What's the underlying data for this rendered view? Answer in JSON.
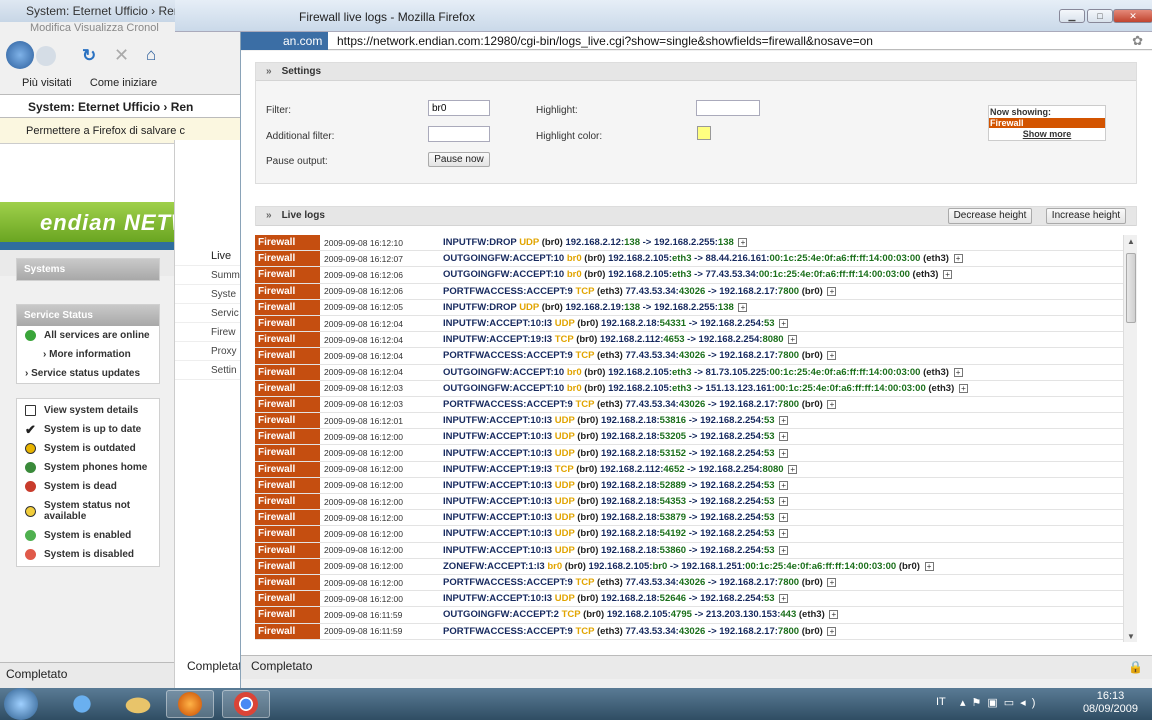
{
  "bg": {
    "title": "System: Eternet Ufficio › Remot",
    "menu": "Modifica  Visualizza  Cronol",
    "bookmarks": [
      "Più visitati",
      "Come iniziare"
    ],
    "tab": "System: Eternet Ufficio › Ren",
    "notify": "Permettere a Firefox di salvare c",
    "brand": "endian NETWORK",
    "systems": "Systems",
    "service_status": "Service Status",
    "svc_items": [
      "All services are online",
      "› More information",
      "› Service status updates"
    ],
    "legend": [
      "View system details",
      "System is up to date",
      "System is outdated",
      "System phones home",
      "System is dead",
      "System status not available",
      "System is enabled",
      "System is disabled"
    ],
    "mid_items": [
      "Live",
      "Summ",
      "Syste",
      "Servic",
      "Firew",
      "Proxy",
      "Settin"
    ],
    "status": "Completato",
    "status2": "Completat"
  },
  "window": {
    "title": "Firewall live logs - Mozilla Firefox",
    "site": "an.com",
    "url": "https://network.endian.com:12980/cgi-bin/logs_live.cgi?show=single&showfields=firewall&nosave=on",
    "status": "Completato"
  },
  "settings": {
    "header": "Settings",
    "filter_label": "Filter:",
    "filter_value": "br0",
    "additional_label": "Additional filter:",
    "additional_value": "",
    "pause_label": "Pause output:",
    "pause_button": "Pause now",
    "highlight_label": "Highlight:",
    "highlight_value": "",
    "highlight_color_label": "Highlight color:",
    "highlight_color": "#ffff80",
    "now_showing": "Now showing:",
    "showing_value": "Firewall",
    "show_more": "Show more"
  },
  "live": {
    "header": "Live logs",
    "decrease": "Decrease height",
    "increase": "Increase height",
    "rows": [
      {
        "src": "Firewall",
        "ts": "2009-09-08 16:12:10",
        "rule": "INPUTFW:DROP",
        "proto": "UDP",
        "iface": "(br0)",
        "from": "192.168.2.12:",
        "fport": "138",
        "arrow": "->",
        "to": "192.168.2.255:",
        "tport": "138",
        "extra": ""
      },
      {
        "src": "Firewall",
        "ts": "2009-09-08 16:12:07",
        "rule": "OUTGOINGFW:ACCEPT:10",
        "proto": "br0",
        "iface": "(br0)",
        "from": "192.168.2.105:",
        "fport": "eth3",
        "arrow": "->",
        "to": "88.44.216.161:",
        "tport": "00:1c:25:4e:0f:a6:ff:ff:14:00:03:00",
        "extra": "(eth3)"
      },
      {
        "src": "Firewall",
        "ts": "2009-09-08 16:12:06",
        "rule": "OUTGOINGFW:ACCEPT:10",
        "proto": "br0",
        "iface": "(br0)",
        "from": "192.168.2.105:",
        "fport": "eth3",
        "arrow": "->",
        "to": "77.43.53.34:",
        "tport": "00:1c:25:4e:0f:a6:ff:ff:14:00:03:00",
        "extra": "(eth3)"
      },
      {
        "src": "Firewall",
        "ts": "2009-09-08 16:12:06",
        "rule": "PORTFWACCESS:ACCEPT:9",
        "proto": "TCP",
        "iface": "(eth3)",
        "from": "77.43.53.34:",
        "fport": "43026",
        "arrow": "->",
        "to": "192.168.2.17:",
        "tport": "7800",
        "extra": "(br0)"
      },
      {
        "src": "Firewall",
        "ts": "2009-09-08 16:12:05",
        "rule": "INPUTFW:DROP",
        "proto": "UDP",
        "iface": "(br0)",
        "from": "192.168.2.19:",
        "fport": "138",
        "arrow": "->",
        "to": "192.168.2.255:",
        "tport": "138",
        "extra": ""
      },
      {
        "src": "Firewall",
        "ts": "2009-09-08 16:12:04",
        "rule": "INPUTFW:ACCEPT:10:l3",
        "proto": "UDP",
        "iface": "(br0)",
        "from": "192.168.2.18:",
        "fport": "54331",
        "arrow": "->",
        "to": "192.168.2.254:",
        "tport": "53",
        "extra": ""
      },
      {
        "src": "Firewall",
        "ts": "2009-09-08 16:12:04",
        "rule": "INPUTFW:ACCEPT:19:l3",
        "proto": "TCP",
        "iface": "(br0)",
        "from": "192.168.2.112:",
        "fport": "4653",
        "arrow": "->",
        "to": "192.168.2.254:",
        "tport": "8080",
        "extra": ""
      },
      {
        "src": "Firewall",
        "ts": "2009-09-08 16:12:04",
        "rule": "PORTFWACCESS:ACCEPT:9",
        "proto": "TCP",
        "iface": "(eth3)",
        "from": "77.43.53.34:",
        "fport": "43026",
        "arrow": "->",
        "to": "192.168.2.17:",
        "tport": "7800",
        "extra": "(br0)"
      },
      {
        "src": "Firewall",
        "ts": "2009-09-08 16:12:04",
        "rule": "OUTGOINGFW:ACCEPT:10",
        "proto": "br0",
        "iface": "(br0)",
        "from": "192.168.2.105:",
        "fport": "eth3",
        "arrow": "->",
        "to": "81.73.105.225:",
        "tport": "00:1c:25:4e:0f:a6:ff:ff:14:00:03:00",
        "extra": "(eth3)"
      },
      {
        "src": "Firewall",
        "ts": "2009-09-08 16:12:03",
        "rule": "OUTGOINGFW:ACCEPT:10",
        "proto": "br0",
        "iface": "(br0)",
        "from": "192.168.2.105:",
        "fport": "eth3",
        "arrow": "->",
        "to": "151.13.123.161:",
        "tport": "00:1c:25:4e:0f:a6:ff:ff:14:00:03:00",
        "extra": "(eth3)"
      },
      {
        "src": "Firewall",
        "ts": "2009-09-08 16:12:03",
        "rule": "PORTFWACCESS:ACCEPT:9",
        "proto": "TCP",
        "iface": "(eth3)",
        "from": "77.43.53.34:",
        "fport": "43026",
        "arrow": "->",
        "to": "192.168.2.17:",
        "tport": "7800",
        "extra": "(br0)"
      },
      {
        "src": "Firewall",
        "ts": "2009-09-08 16:12:01",
        "rule": "INPUTFW:ACCEPT:10:l3",
        "proto": "UDP",
        "iface": "(br0)",
        "from": "192.168.2.18:",
        "fport": "53816",
        "arrow": "->",
        "to": "192.168.2.254:",
        "tport": "53",
        "extra": ""
      },
      {
        "src": "Firewall",
        "ts": "2009-09-08 16:12:00",
        "rule": "INPUTFW:ACCEPT:10:l3",
        "proto": "UDP",
        "iface": "(br0)",
        "from": "192.168.2.18:",
        "fport": "53205",
        "arrow": "->",
        "to": "192.168.2.254:",
        "tport": "53",
        "extra": ""
      },
      {
        "src": "Firewall",
        "ts": "2009-09-08 16:12:00",
        "rule": "INPUTFW:ACCEPT:10:l3",
        "proto": "UDP",
        "iface": "(br0)",
        "from": "192.168.2.18:",
        "fport": "53152",
        "arrow": "->",
        "to": "192.168.2.254:",
        "tport": "53",
        "extra": ""
      },
      {
        "src": "Firewall",
        "ts": "2009-09-08 16:12:00",
        "rule": "INPUTFW:ACCEPT:19:l3",
        "proto": "TCP",
        "iface": "(br0)",
        "from": "192.168.2.112:",
        "fport": "4652",
        "arrow": "->",
        "to": "192.168.2.254:",
        "tport": "8080",
        "extra": ""
      },
      {
        "src": "Firewall",
        "ts": "2009-09-08 16:12:00",
        "rule": "INPUTFW:ACCEPT:10:l3",
        "proto": "UDP",
        "iface": "(br0)",
        "from": "192.168.2.18:",
        "fport": "52889",
        "arrow": "->",
        "to": "192.168.2.254:",
        "tport": "53",
        "extra": ""
      },
      {
        "src": "Firewall",
        "ts": "2009-09-08 16:12:00",
        "rule": "INPUTFW:ACCEPT:10:l3",
        "proto": "UDP",
        "iface": "(br0)",
        "from": "192.168.2.18:",
        "fport": "54353",
        "arrow": "->",
        "to": "192.168.2.254:",
        "tport": "53",
        "extra": ""
      },
      {
        "src": "Firewall",
        "ts": "2009-09-08 16:12:00",
        "rule": "INPUTFW:ACCEPT:10:l3",
        "proto": "UDP",
        "iface": "(br0)",
        "from": "192.168.2.18:",
        "fport": "53879",
        "arrow": "->",
        "to": "192.168.2.254:",
        "tport": "53",
        "extra": ""
      },
      {
        "src": "Firewall",
        "ts": "2009-09-08 16:12:00",
        "rule": "INPUTFW:ACCEPT:10:l3",
        "proto": "UDP",
        "iface": "(br0)",
        "from": "192.168.2.18:",
        "fport": "54192",
        "arrow": "->",
        "to": "192.168.2.254:",
        "tport": "53",
        "extra": ""
      },
      {
        "src": "Firewall",
        "ts": "2009-09-08 16:12:00",
        "rule": "INPUTFW:ACCEPT:10:l3",
        "proto": "UDP",
        "iface": "(br0)",
        "from": "192.168.2.18:",
        "fport": "53860",
        "arrow": "->",
        "to": "192.168.2.254:",
        "tport": "53",
        "extra": ""
      },
      {
        "src": "Firewall",
        "ts": "2009-09-08 16:12:00",
        "rule": "ZONEFW:ACCEPT:1:l3",
        "proto": "br0",
        "iface": "(br0)",
        "from": "192.168.2.105:",
        "fport": "br0",
        "arrow": "->",
        "to": "192.168.1.251:",
        "tport": "00:1c:25:4e:0f:a6:ff:ff:14:00:03:00",
        "extra": "(br0)"
      },
      {
        "src": "Firewall",
        "ts": "2009-09-08 16:12:00",
        "rule": "PORTFWACCESS:ACCEPT:9",
        "proto": "TCP",
        "iface": "(eth3)",
        "from": "77.43.53.34:",
        "fport": "43026",
        "arrow": "->",
        "to": "192.168.2.17:",
        "tport": "7800",
        "extra": "(br0)"
      },
      {
        "src": "Firewall",
        "ts": "2009-09-08 16:12:00",
        "rule": "INPUTFW:ACCEPT:10:l3",
        "proto": "UDP",
        "iface": "(br0)",
        "from": "192.168.2.18:",
        "fport": "52646",
        "arrow": "->",
        "to": "192.168.2.254:",
        "tport": "53",
        "extra": ""
      },
      {
        "src": "Firewall",
        "ts": "2009-09-08 16:11:59",
        "rule": "OUTGOINGFW:ACCEPT:2",
        "proto": "TCP",
        "iface": "(br0)",
        "from": "192.168.2.105:",
        "fport": "4795",
        "arrow": "->",
        "to": "213.203.130.153:",
        "tport": "443",
        "extra": "(eth3)"
      },
      {
        "src": "Firewall",
        "ts": "2009-09-08 16:11:59",
        "rule": "PORTFWACCESS:ACCEPT:9",
        "proto": "TCP",
        "iface": "(eth3)",
        "from": "77.43.53.34:",
        "fport": "43026",
        "arrow": "->",
        "to": "192.168.2.17:",
        "tport": "7800",
        "extra": "(br0)"
      }
    ]
  },
  "taskbar": {
    "lang": "IT",
    "time": "16:13",
    "date": "08/09/2009"
  },
  "colors": {
    "source": "#c54e10",
    "proto": "#e1a400",
    "port": "#1b6f1b",
    "brand_green": "#6aa521"
  }
}
